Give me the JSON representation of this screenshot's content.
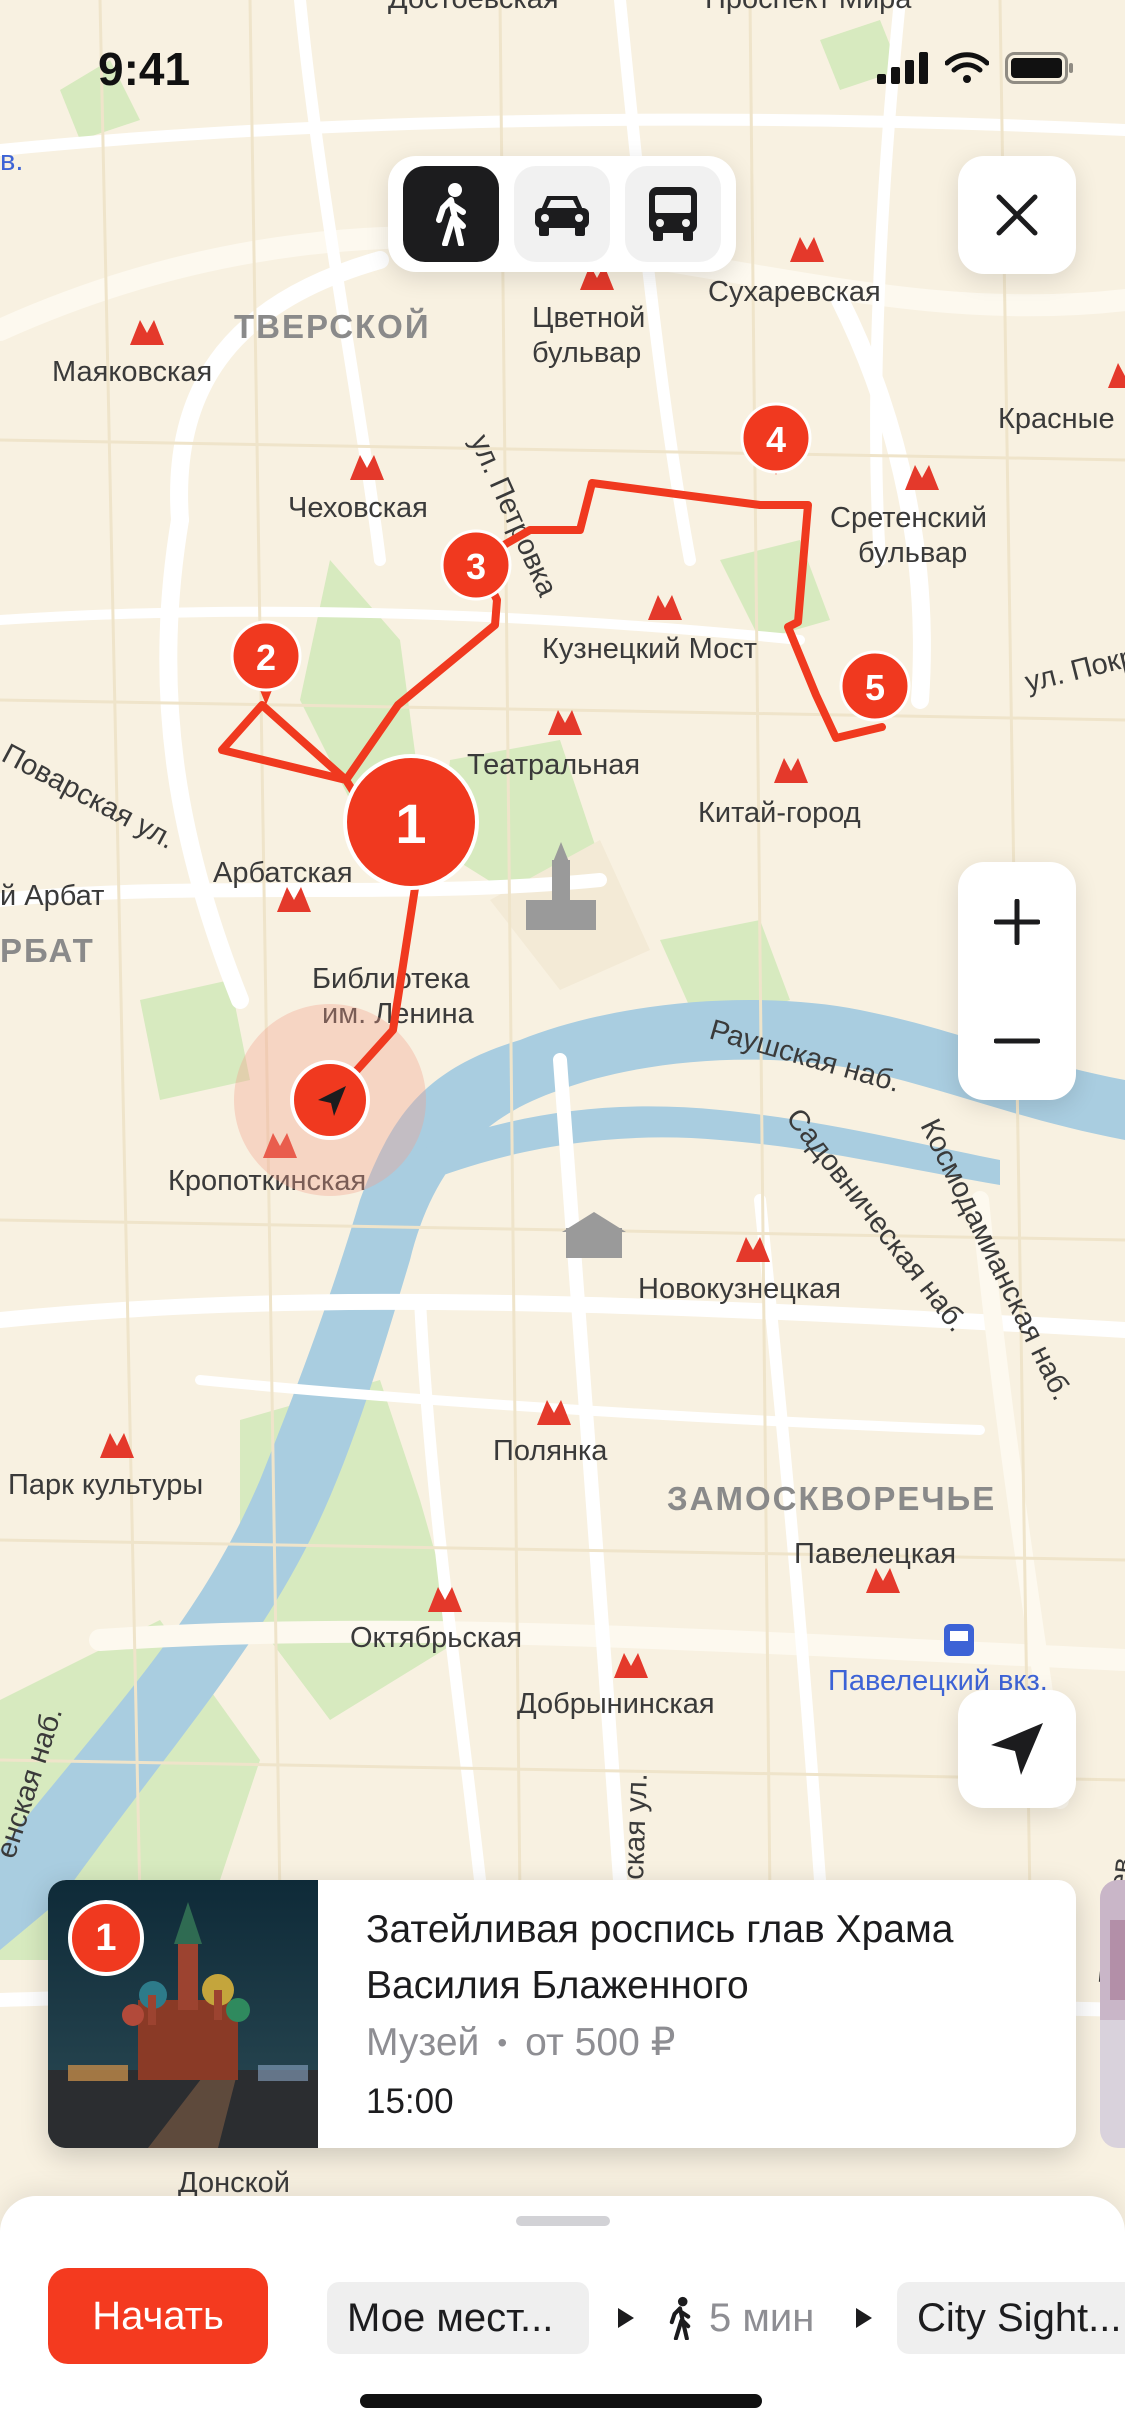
{
  "status_bar": {
    "time": "9:41"
  },
  "map": {
    "labels": {
      "dostoevskaya": "Достоевская",
      "prospekt_mira": "Проспект Мира",
      "tverskoy": "ТВЕРСКОЙ",
      "tsvetnoy_1": "Цветной",
      "tsvetnoy_2": "бульвар",
      "sukharevskaya": "Сухаревская",
      "mayakovskaya": "Маяковская",
      "krasnye": "Красные",
      "chekhovskaya": "Чеховская",
      "petrovka": "ул. Петровка",
      "sretensky_1": "Сретенский",
      "sretensky_2": "бульвар",
      "kuznetsky": "Кузнецкий Мост",
      "pokrovka": "ул. Покр",
      "povarskaya": "Поварская ул.",
      "teatralnaya": "Театральная",
      "kitay_gorod": "Китай-город",
      "arbatskaya": "Арбатская",
      "arbat_street": "й Арбат",
      "arbat_district": "РБАТ",
      "library_1": "Библиотека",
      "library_2": "им. Ленина",
      "raushskaya": "Раушская наб.",
      "sadovnicheskaya": "Садовническая наб.",
      "kosmodamianskaya": "Космодамианская наб.",
      "kropotkinskaya": "Кропоткинская",
      "novokuznetskaya": "Новокузнецкая",
      "polyanka": "Полянка",
      "park_kultury": "Парк культуры",
      "zamoskvorechye": "ЗАМОСКВОРЕЧЬЕ",
      "paveletskaya": "Павелецкая",
      "oktyabrskaya": "Октябрьская",
      "paveletsky_vokzal": "Павелецкий вкз.",
      "dobryninskaya": "Добрынинская",
      "embankment": "енская наб.",
      "street_vertical": "ская ул.",
      "derbenevskaya": "Дербенев",
      "donskoy": "Донской",
      "edge_v": "в."
    },
    "route_points": [
      "1",
      "2",
      "3",
      "4",
      "5"
    ]
  },
  "transport_modes": [
    {
      "name": "walking-icon",
      "active": true
    },
    {
      "name": "car-icon",
      "active": false
    },
    {
      "name": "bus-icon",
      "active": false
    }
  ],
  "controls": {
    "close_icon": "close-icon",
    "zoom_in": "+",
    "zoom_out": "−",
    "locate_icon": "navigation-arrow-icon"
  },
  "place_card": {
    "badge": "1",
    "title": "Затейливая роспись глав Храма Василия Блаженного",
    "category": "Музей",
    "separator": "•",
    "price": "от 500 ₽",
    "time": "15:00"
  },
  "bottom_sheet": {
    "start_label": "Начать",
    "from": "Мое мест...",
    "duration": "5 мин",
    "to": "City Sight..."
  },
  "colors": {
    "route": "#f0391f",
    "accent_button": "#f43a1f",
    "map_background": "#f8f1e1",
    "river": "#a9cde0",
    "park": "#d5e9bd"
  }
}
